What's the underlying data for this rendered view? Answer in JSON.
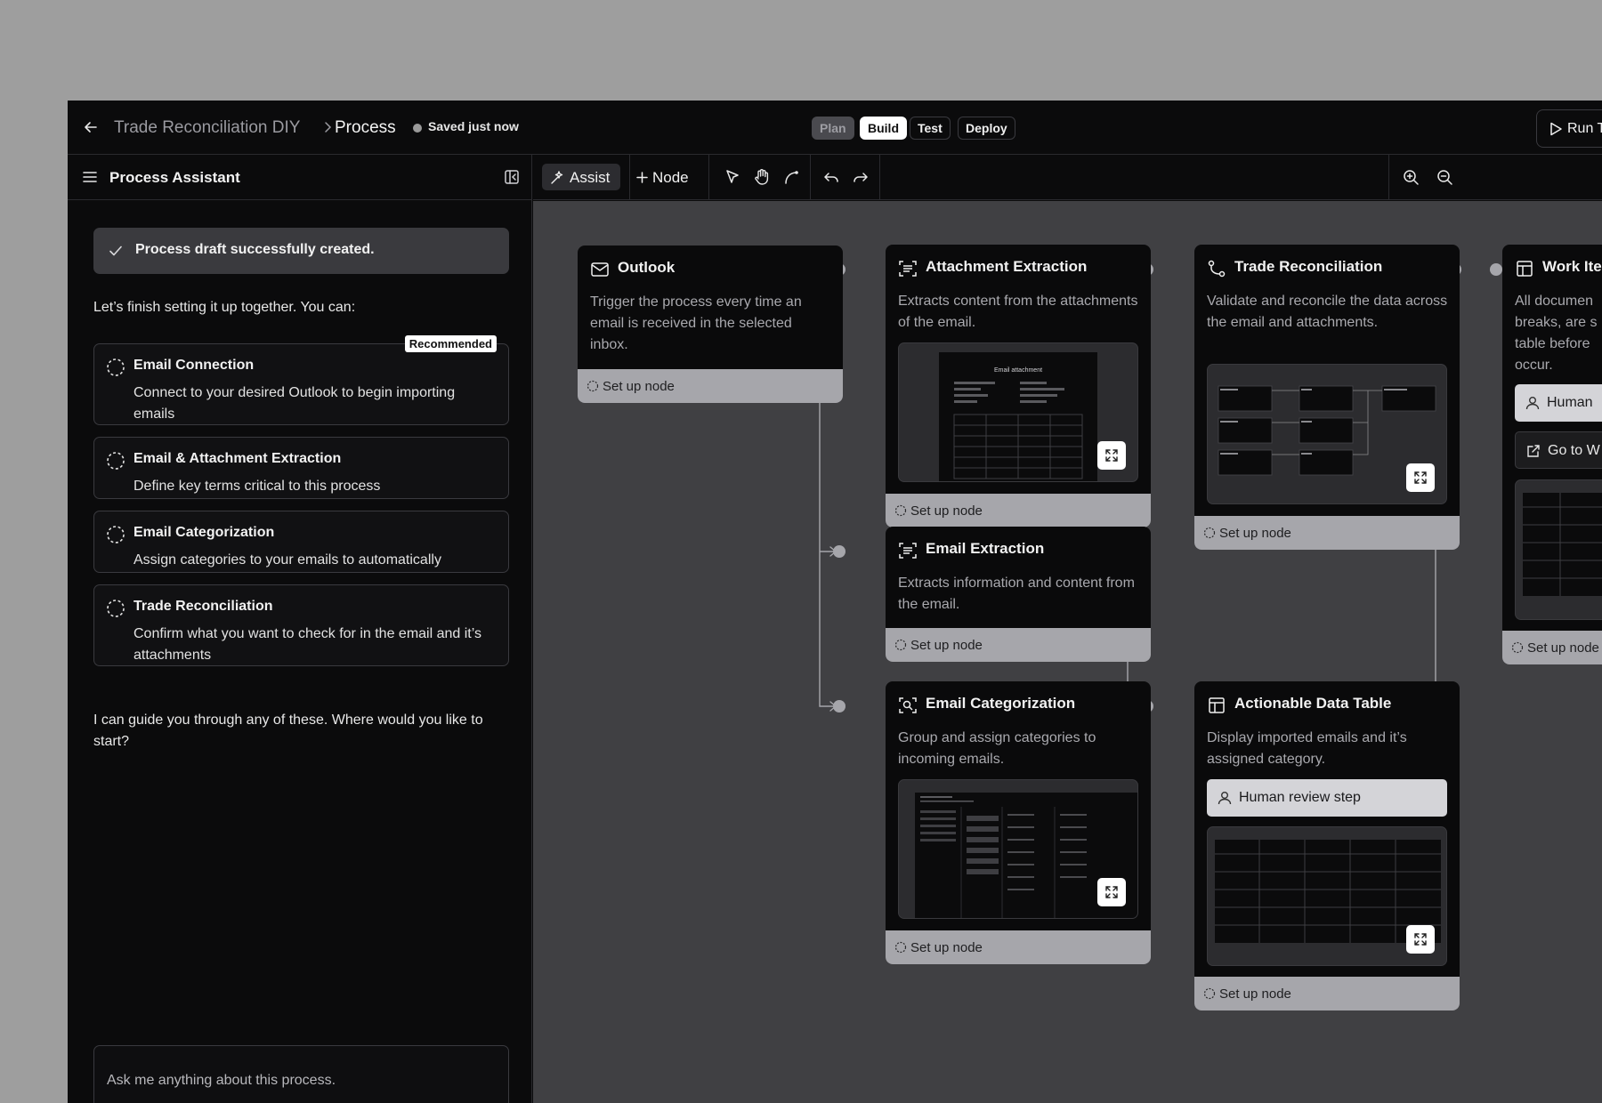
{
  "header": {
    "breadcrumb_root": "Trade Reconciliation DIY",
    "breadcrumb_current": "Process",
    "saved_status": "Saved just now",
    "modes": [
      "Plan",
      "Build",
      "Test",
      "Deploy"
    ],
    "active_mode": "Build",
    "run_label": "Run T"
  },
  "assistant": {
    "title": "Process Assistant",
    "success_message": "Process draft successfully created.",
    "intro": "Let’s finish setting it up together. You can:",
    "recommended_badge": "Recommended",
    "steps": [
      {
        "title": "Email Connection",
        "desc": "Connect to your desired Outlook to begin importing emails"
      },
      {
        "title": "Email & Attachment Extraction",
        "desc": "Define key terms critical to this process"
      },
      {
        "title": "Email Categorization",
        "desc": "Assign categories to your emails to automatically"
      },
      {
        "title": "Trade Reconciliation",
        "desc": "Confirm what you want to check for in the email and it’s attachments"
      }
    ],
    "outro": "I can guide you through any of these. Where would you like to start?",
    "input_placeholder": "Ask me anything about this process."
  },
  "toolbar": {
    "assist_label": "Assist",
    "node_label": "Node"
  },
  "canvas": {
    "setup_label": "Set up node",
    "nodes": {
      "outlook": {
        "title": "Outlook",
        "desc": "Trigger the process every time an email is received in the selected inbox."
      },
      "attachment": {
        "title": "Attachment Extraction",
        "desc": "Extracts content from the attachments of the email.",
        "preview_title": "Email attachment"
      },
      "recon": {
        "title": "Trade Reconciliation",
        "desc": "Validate and reconcile the data across the email and attachments."
      },
      "worktable": {
        "title": "Work Ite",
        "desc": "All documen breaks, are s table before occur.",
        "human_label": "Human",
        "goto_label": "Go to W"
      },
      "email_extract": {
        "title": "Email Extraction",
        "desc": "Extracts information and content from the email."
      },
      "categorize": {
        "title": "Email Categorization",
        "desc": "Group and assign categories to incoming emails."
      },
      "actionable": {
        "title": "Actionable Data Table",
        "desc": "Display imported emails and it’s assigned category.",
        "human_label": "Human review step"
      }
    }
  },
  "colors": {
    "app_bg": "#0b0b0c",
    "canvas_bg": "#404043",
    "node_bg": "#0a0a0b",
    "footer_bg": "#a6a6ab",
    "accent": "#ffffff"
  }
}
